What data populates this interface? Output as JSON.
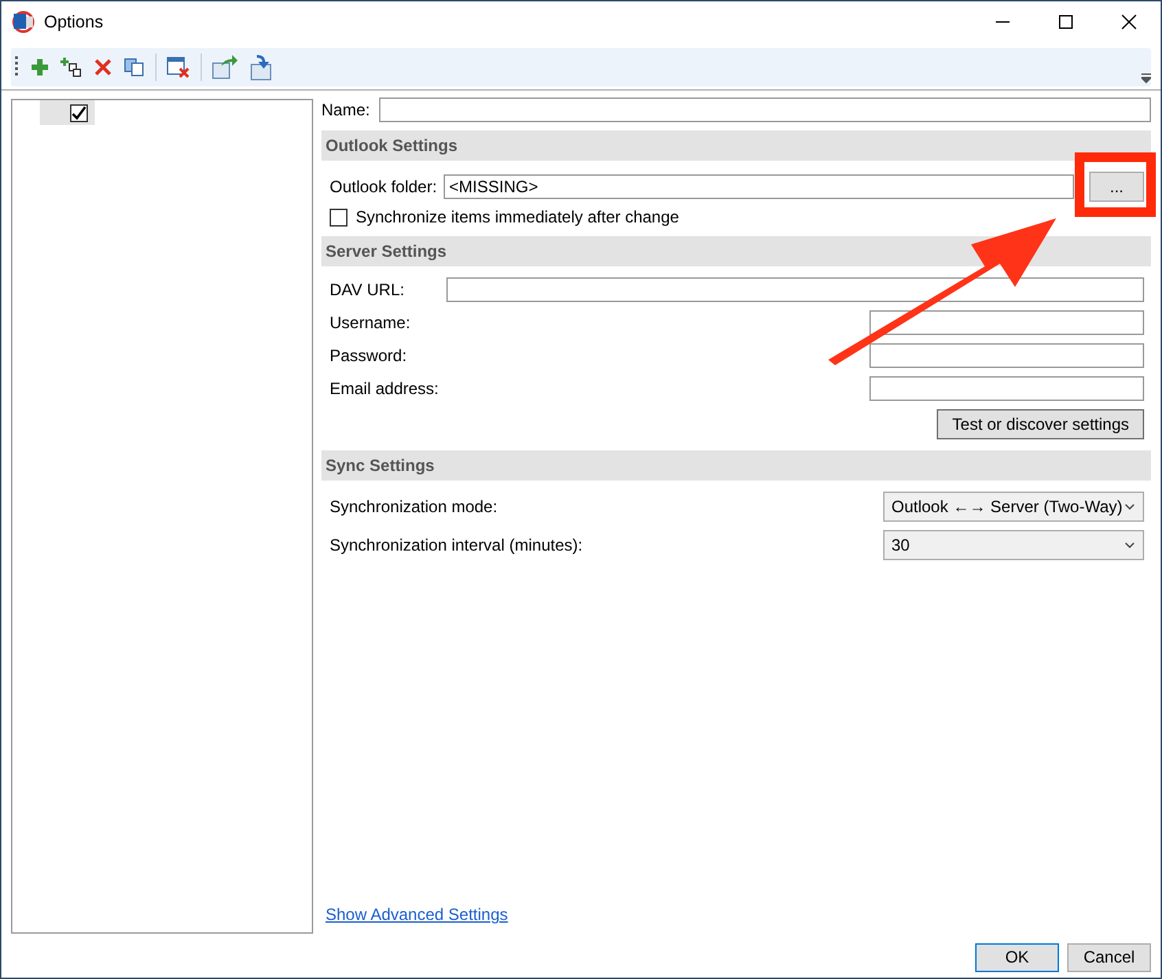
{
  "window": {
    "title": "Options"
  },
  "tree": {
    "items": [
      {
        "checked": true,
        "selected": true
      }
    ]
  },
  "name_field": {
    "label": "Name:"
  },
  "outlook_settings": {
    "heading": "Outlook Settings",
    "folder_label": "Outlook folder:",
    "folder_value": "<MISSING>",
    "browse_button": "...",
    "sync_immediately": {
      "label": "Synchronize items immediately after change",
      "checked": false
    }
  },
  "server_settings": {
    "heading": "Server Settings",
    "fields": [
      {
        "label": "DAV URL:",
        "wide": true
      },
      {
        "label": "Username:",
        "wide": false
      },
      {
        "label": "Password:",
        "wide": false
      },
      {
        "label": "Email address:",
        "wide": false
      }
    ],
    "test_button": "Test or discover settings"
  },
  "sync_settings": {
    "heading": "Sync Settings",
    "rows": [
      {
        "label": "Synchronization mode:",
        "value": "Outlook ←→ Server (Two-Way)"
      },
      {
        "label": "Synchronization interval (minutes):",
        "value": "30"
      }
    ]
  },
  "advanced_link": "Show Advanced Settings",
  "buttons": [
    {
      "label": "OK",
      "default": true
    },
    {
      "label": "Cancel",
      "default": false
    }
  ]
}
